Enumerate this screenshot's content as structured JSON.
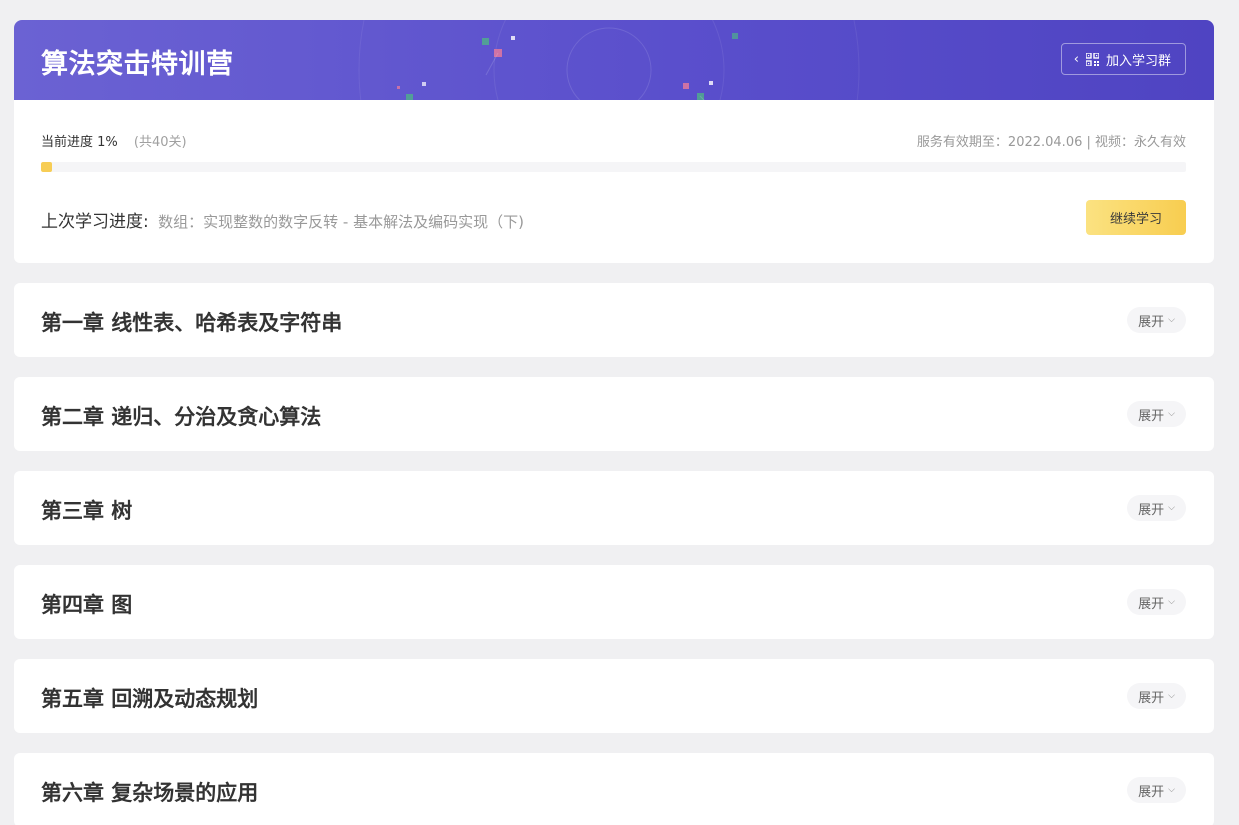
{
  "banner": {
    "title": "算法突击特训营",
    "join_label": "加入学习群"
  },
  "progress": {
    "label": "当前进度 1%",
    "total": "(共40关)",
    "percent": 1,
    "service_info": "服务有效期至：2022.04.06 | 视频：永久有效"
  },
  "last_study": {
    "label": "上次学习进度:",
    "value": "数组：实现整数的数字反转 - 基本解法及编码实现（下)",
    "continue_label": "继续学习"
  },
  "chapters": [
    {
      "title": "第一章 线性表、哈希表及字符串",
      "expand_label": "展开"
    },
    {
      "title": "第二章 递归、分治及贪心算法",
      "expand_label": "展开"
    },
    {
      "title": "第三章 树",
      "expand_label": "展开"
    },
    {
      "title": "第四章 图",
      "expand_label": "展开"
    },
    {
      "title": "第五章 回溯及动态规划",
      "expand_label": "展开"
    },
    {
      "title": "第六章 复杂场景的应用",
      "expand_label": "展开"
    }
  ],
  "colors": {
    "banner_start": "#6b62d3",
    "banner_end": "#4f44c2",
    "accent_yellow": "#f8cd50",
    "background": "#f0f0f2"
  },
  "icons": {
    "join_chevron": "chevron-left-icon",
    "join_qr": "qr-code-icon",
    "expand_chevron": "chevron-down-icon"
  }
}
